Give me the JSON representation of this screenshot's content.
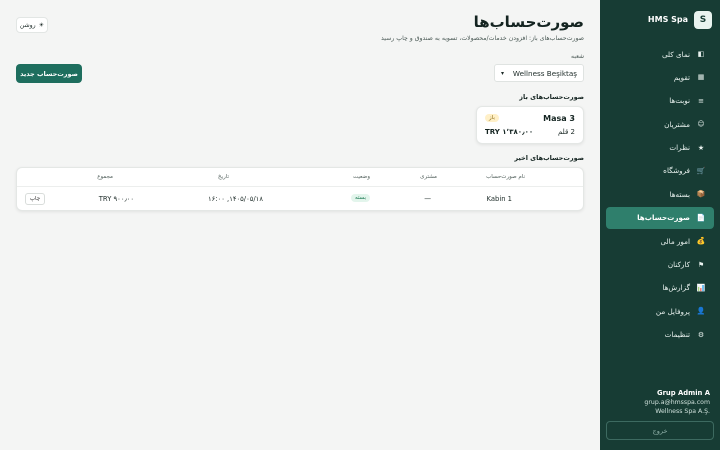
{
  "sidebar": {
    "brand_letter": "S",
    "brand_name": "HMS Spa",
    "items": [
      {
        "label": "نمای کلی",
        "icon": "◧"
      },
      {
        "label": "تقویم",
        "icon": "▦"
      },
      {
        "label": "نوبت‌ها",
        "icon": "≡"
      },
      {
        "label": "مشتریان",
        "icon": "☺"
      },
      {
        "label": "نظرات",
        "icon": "★"
      },
      {
        "label": "فروشگاه",
        "icon": "🛒"
      },
      {
        "label": "بسته‌ها",
        "icon": "📦"
      },
      {
        "label": "صورت‌حساب‌ها",
        "icon": "📄"
      },
      {
        "label": "امور مالی",
        "icon": "💰"
      },
      {
        "label": "کارکنان",
        "icon": "⚑"
      },
      {
        "label": "گزارش‌ها",
        "icon": "📊"
      },
      {
        "label": "پروفایل من",
        "icon": "👤"
      },
      {
        "label": "تنظیمات",
        "icon": "⚙"
      }
    ],
    "active_index": 7,
    "user_name": "Grup Admin A",
    "user_email": "grup.a@hmsspa.com",
    "company": "Wellness Spa A.Ş.",
    "logout_label": "خروج"
  },
  "header": {
    "title": "صورت‌حساب‌ها",
    "subtitle": "صورت‌حساب‌های باز: افزودن خدمات/محصولات، تسویه به صندوق و چاپ رسید",
    "theme_label": "روشن",
    "theme_icon": "☀"
  },
  "branch": {
    "label": "شعبه",
    "selected": "Wellness Beşiktaş"
  },
  "new_button_label": "صورت‌حساب جدید",
  "open_section": {
    "title": "صورت‌حساب‌های باز",
    "cards": [
      {
        "name": "Masa 3",
        "badge": "باز",
        "items": "2 قلم",
        "total": "TRY ۱٬۳۸۰٫۰۰"
      }
    ]
  },
  "recent_section": {
    "title": "صورت‌حساب‌های اخیر",
    "columns": {
      "name": "نام صورت‌حساب",
      "customer": "مشتری",
      "status": "وضعیت",
      "date": "تاریخ",
      "total": "مجموع"
    },
    "rows": [
      {
        "name": "Kabin 1",
        "customer": "—",
        "status": "بسته",
        "date": "۱۴۰۵/۰۵/۱۸, ۱۶:۰۰",
        "total": "TRY ۹۰۰٫۰۰",
        "action": "چاپ"
      }
    ]
  },
  "colors": {
    "sidebar_bg": "#173c34",
    "accent": "#1e6e5e",
    "active_item": "#2f7f6c"
  }
}
